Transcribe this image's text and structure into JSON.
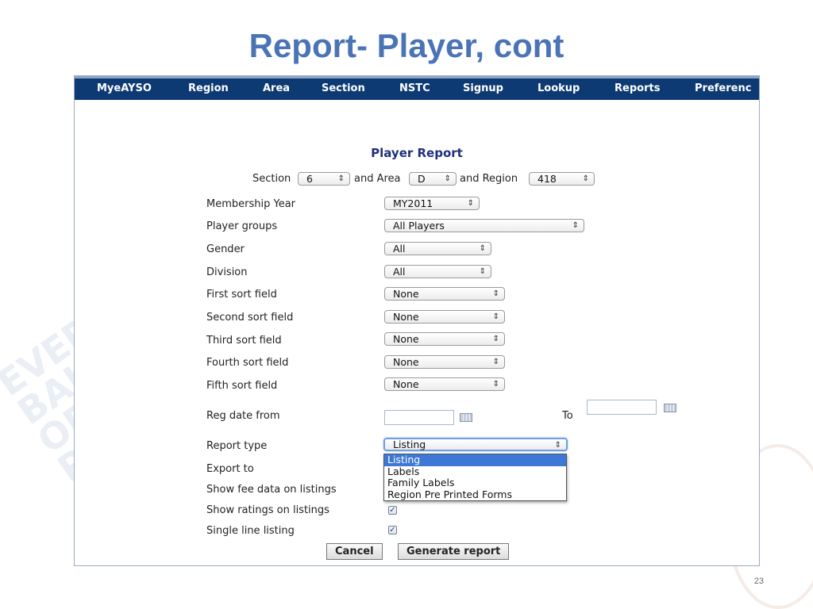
{
  "slide": {
    "title": "Report- Player, cont",
    "page_number": "23"
  },
  "nav": {
    "items": [
      "MyeAYSO",
      "Region",
      "Area",
      "Section",
      "NSTC",
      "Signup",
      "Lookup",
      "Reports",
      "Preferenc"
    ]
  },
  "report": {
    "title": "Player Report",
    "section_label": "Section",
    "section_value": "6",
    "area_label": "and Area",
    "area_value": "D",
    "region_label": "and Region",
    "region_value": "418"
  },
  "fields": {
    "membership_year": {
      "label": "Membership Year",
      "value": "MY2011"
    },
    "player_groups": {
      "label": "Player groups",
      "value": "All Players"
    },
    "gender": {
      "label": "Gender",
      "value": "All"
    },
    "division": {
      "label": "Division",
      "value": "All"
    },
    "first_sort": {
      "label": "First sort field",
      "value": "None"
    },
    "second_sort": {
      "label": "Second sort field",
      "value": "None"
    },
    "third_sort": {
      "label": "Third sort field",
      "value": "None"
    },
    "fourth_sort": {
      "label": "Fourth sort field",
      "value": "None"
    },
    "fifth_sort": {
      "label": "Fifth sort field",
      "value": "None"
    },
    "reg_date_from": {
      "label": "Reg date from",
      "value": ""
    },
    "reg_date_to": {
      "label": "To",
      "value": ""
    },
    "report_type": {
      "label": "Report type",
      "value": "Listing"
    },
    "export_to": {
      "label": "Export to"
    },
    "show_fee": {
      "label": "Show fee data on listings"
    },
    "show_ratings": {
      "label": "Show ratings on listings",
      "checked": true
    },
    "single_line": {
      "label": "Single line listing",
      "checked": true
    }
  },
  "report_type_options": [
    "Listing",
    "Labels",
    "Family Labels",
    "Region Pre Printed Forms"
  ],
  "buttons": {
    "cancel": "Cancel",
    "generate": "Generate report"
  },
  "icons": {
    "select_arrow": "updown-arrow-icon",
    "calendar": "calendar-icon",
    "check": "checkmark-icon"
  },
  "colors": {
    "title": "#4a74b5",
    "navbar": "#0d3a73",
    "report_title": "#1f2f7a",
    "highlight": "#3e78d6"
  }
}
